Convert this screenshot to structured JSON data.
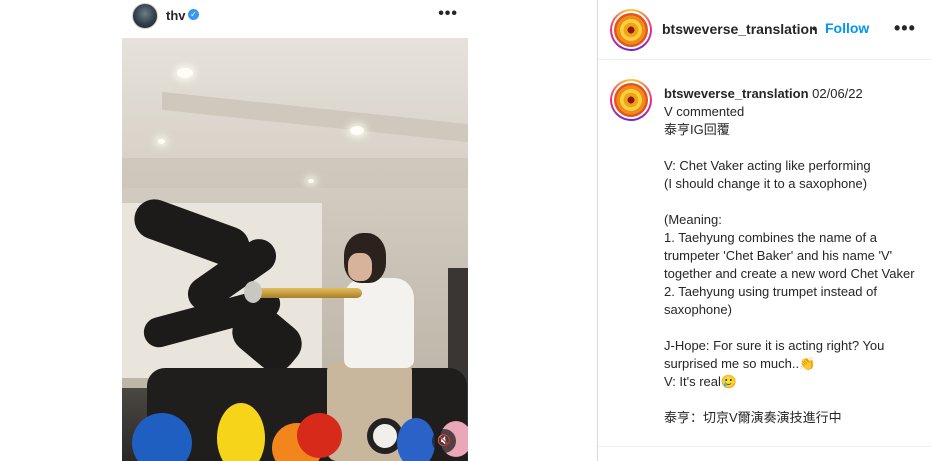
{
  "media": {
    "username": "thv",
    "verified_icon": "verified-badge-icon",
    "more_icon": "more-horizontal-icon",
    "more_glyph": "•••",
    "mute_icon": "speaker-muted-icon",
    "mute_glyph": "🔇"
  },
  "panel": {
    "username": "btsweverse_translation",
    "dot": "•",
    "follow_label": "Follow",
    "more_glyph": "•••"
  },
  "caption": {
    "username": "btsweverse_translation",
    "date": "02/06/22",
    "lines": [
      "V commented",
      "泰亨IG回覆",
      "",
      "V: Chet Vaker acting like performing",
      "(I should change it to a saxophone)",
      "",
      "(Meaning:",
      "1. Taehyung combines the name of a trumpeter 'Chet Baker' and his name 'V' together and create a new word Chet Vaker",
      "2. Taehyung using trumpet instead of saxophone)",
      "",
      "J-Hope: For sure it is acting right? You surprised me so much..👏",
      "V: It's real🥲",
      "",
      "泰亨：切京V爾演奏演技進行中"
    ]
  },
  "colors": {
    "accent_blue": "#0095f6",
    "verified_blue": "#3897f0",
    "text": "#262626",
    "border": "#dbdbdb"
  }
}
